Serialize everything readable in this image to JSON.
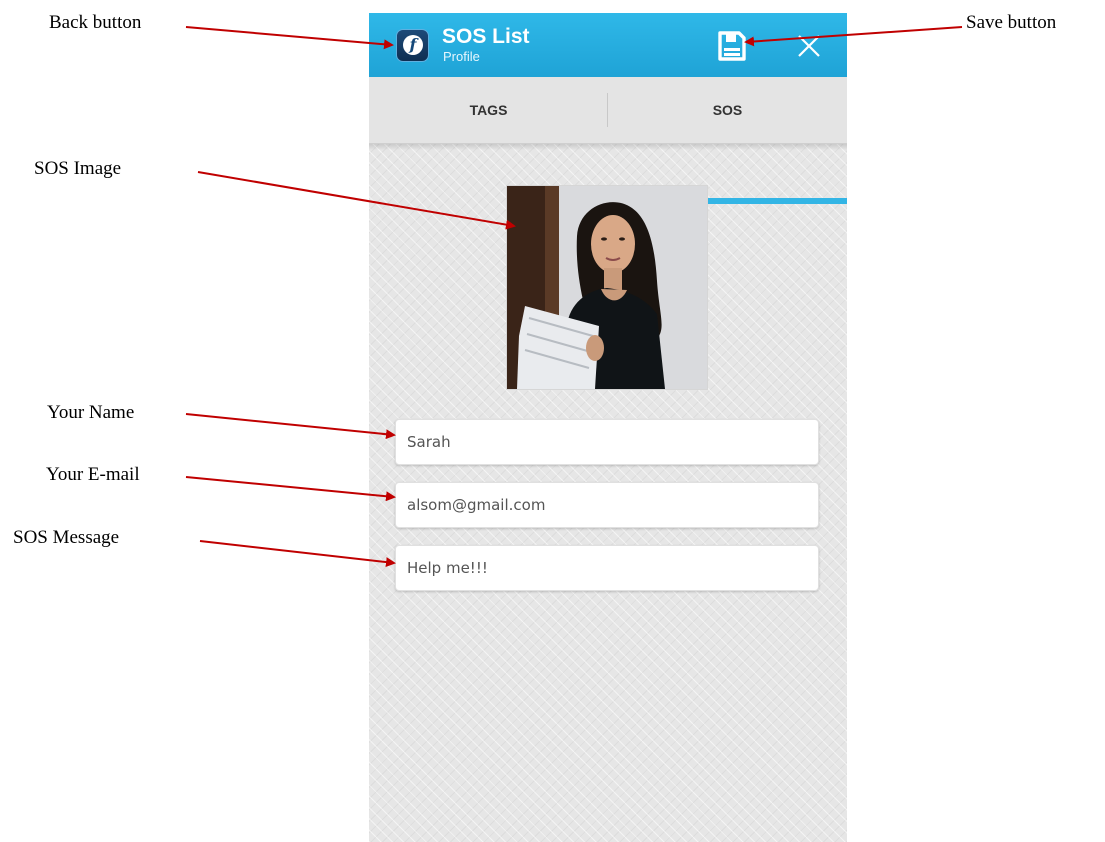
{
  "annotations": {
    "back_button": "Back button",
    "save_button": "Save button",
    "sos_image": "SOS Image",
    "your_name": "Your Name",
    "your_email": "Your E-mail",
    "sos_message": "SOS Message"
  },
  "app_bar": {
    "title": "SOS List",
    "subtitle": "Profile",
    "app_icon": "app-logo-icon",
    "save_icon": "floppy-disk-icon",
    "close_icon": "close-icon",
    "color": "#1fa3d6"
  },
  "tabs": [
    {
      "label": "TAGS",
      "selected": false
    },
    {
      "label": "SOS",
      "selected": true
    }
  ],
  "tab_indicator_color": "#33b5e5",
  "form": {
    "name": {
      "value": "Sarah"
    },
    "email": {
      "value": "alsom@gmail.com"
    },
    "message": {
      "value": "Help me!!!"
    }
  },
  "annotation_arrow_color": "#c00000"
}
